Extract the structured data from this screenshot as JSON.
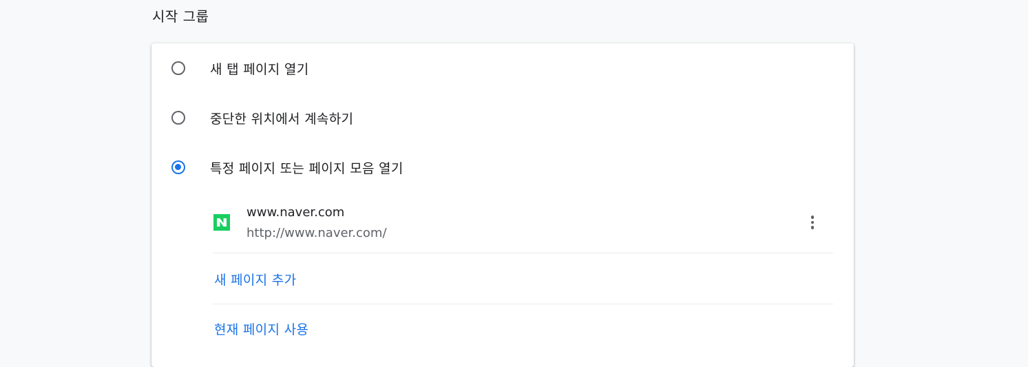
{
  "section": {
    "title": "시작 그룹"
  },
  "options": [
    {
      "label": "새 탭 페이지 열기",
      "checked": false
    },
    {
      "label": "중단한 위치에서 계속하기",
      "checked": false
    },
    {
      "label": "특정 페이지 또는 페이지 모음 열기",
      "checked": true
    }
  ],
  "startup_pages": [
    {
      "title": "www.naver.com",
      "url": "http://www.naver.com/",
      "favicon": "naver-n-icon",
      "favicon_color": "#19ce60"
    }
  ],
  "actions": {
    "add_page": "새 페이지 추가",
    "use_current": "현재 페이지 사용"
  },
  "colors": {
    "accent": "#1a73e8",
    "text": "#202124",
    "secondary_text": "#5f6368",
    "background": "#f8f9fa"
  }
}
